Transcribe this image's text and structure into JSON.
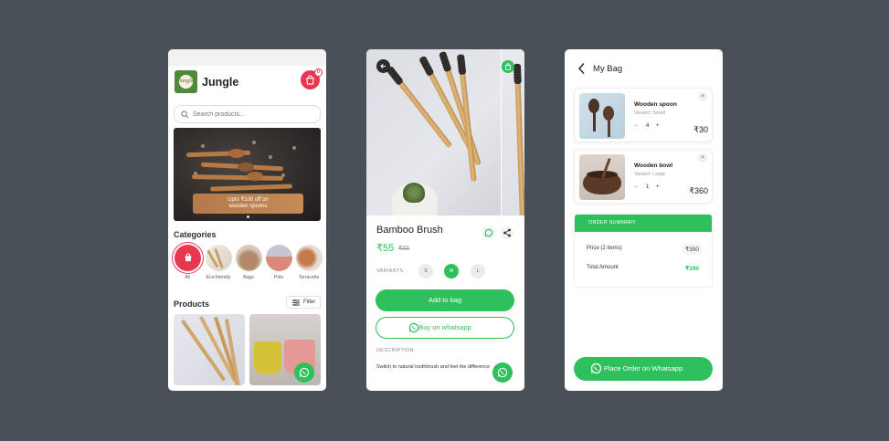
{
  "colors": {
    "background": "#4a5058",
    "accent": "#2ec05d",
    "cart": "#e8384f"
  },
  "home": {
    "brand_logo_text": "Jungle",
    "app_name": "Jungle",
    "cart_count": "0",
    "search": {
      "placeholder": "Search products..."
    },
    "banner": {
      "cta_line1": "Upto ₹100 off on",
      "cta_line2": "wooden spoons"
    },
    "categories_title": "Categories",
    "categories": [
      {
        "label": "All",
        "icon": "bag-icon"
      },
      {
        "label": "Eco-friendly",
        "icon": "toothbrush-thumb"
      },
      {
        "label": "Bags",
        "icon": "bag-thumb"
      },
      {
        "label": "Pots",
        "icon": "pot-thumb"
      },
      {
        "label": "Terracotta",
        "icon": "terracotta-thumb"
      }
    ],
    "products_title": "Products",
    "filter_label": "Filter"
  },
  "product": {
    "name": "Bamboo Brush",
    "price": "₹55",
    "old_price": "₹65",
    "variants_label": "VARIANTS:",
    "variants": [
      "S",
      "M",
      "L"
    ],
    "selected_variant": "M",
    "add_to_bag": "Add to bag",
    "buy_whatsapp": "Buy on whatsapp",
    "description_label": "DESCRIPTION",
    "description": "Switch to natural toothbrush and feel the difference"
  },
  "bag": {
    "title": "My Bag",
    "items": [
      {
        "name": "Wooden spoon",
        "variant": "Variant: Small",
        "qty": "4",
        "price": "₹30"
      },
      {
        "name": "Wooden bowl",
        "variant": "Variant: Large",
        "qty": "1",
        "price": "₹360"
      }
    ],
    "summary_title": "ORDER SUMMARY",
    "price_label": "Price (2 items)",
    "price_value": "₹390",
    "total_label": "Total Amount",
    "total_value": "₹390",
    "place_order": "Place Order on Whatsapp"
  }
}
